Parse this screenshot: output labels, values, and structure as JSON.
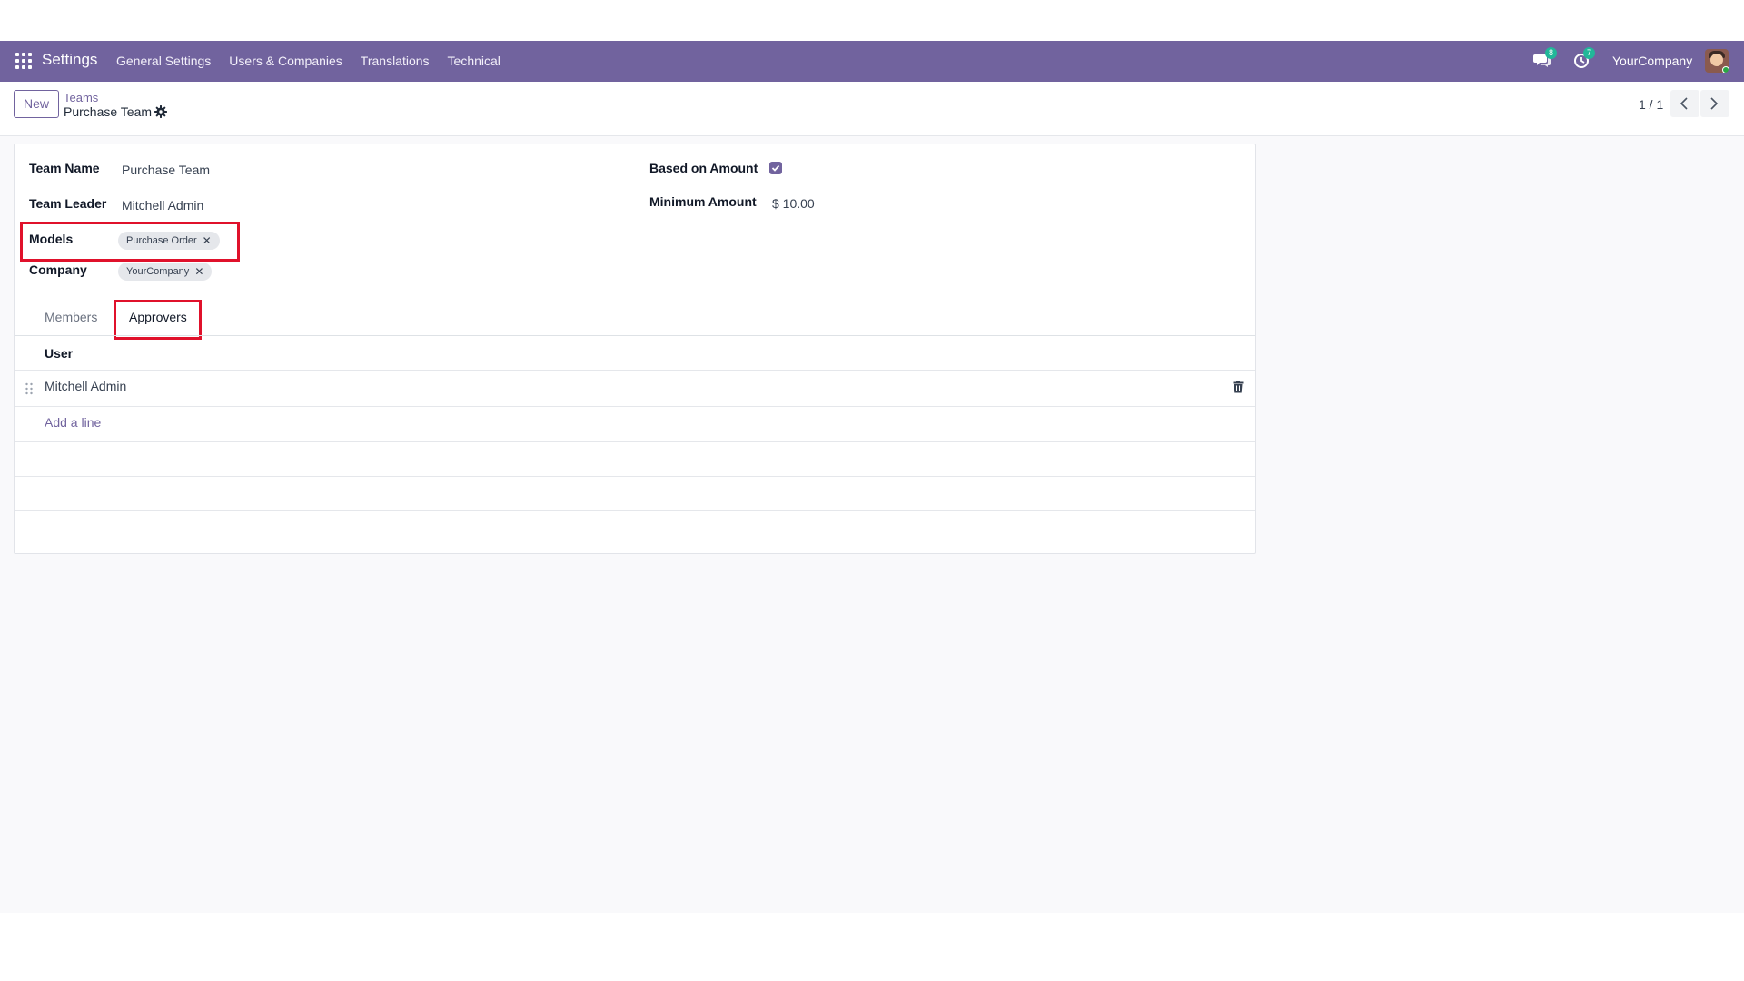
{
  "navbar": {
    "app_title": "Settings",
    "menu": [
      {
        "label": "General Settings"
      },
      {
        "label": "Users & Companies"
      },
      {
        "label": "Translations"
      },
      {
        "label": "Technical"
      }
    ],
    "messages_badge": "8",
    "activities_badge": "7",
    "company": "YourCompany",
    "accent_color": "#71639e"
  },
  "control_panel": {
    "new_label": "New",
    "breadcrumb_parent": "Teams",
    "breadcrumb_current": "Purchase Team",
    "pager": "1 / 1"
  },
  "form": {
    "team_name_label": "Team Name",
    "team_name_value": "Purchase Team",
    "team_leader_label": "Team Leader",
    "team_leader_value": "Mitchell Admin",
    "models_label": "Models",
    "models_tag": "Purchase Order",
    "company_label": "Company",
    "company_tag": "YourCompany",
    "based_on_amount_label": "Based on Amount",
    "based_on_amount_checked": true,
    "minimum_amount_label": "Minimum Amount",
    "minimum_amount_value": "$ 10.00"
  },
  "tabs": {
    "members": "Members",
    "approvers": "Approvers",
    "active": "Approvers"
  },
  "approvers_table": {
    "column_user": "User",
    "rows": [
      {
        "user": "Mitchell Admin"
      }
    ],
    "add_line": "Add a line"
  }
}
